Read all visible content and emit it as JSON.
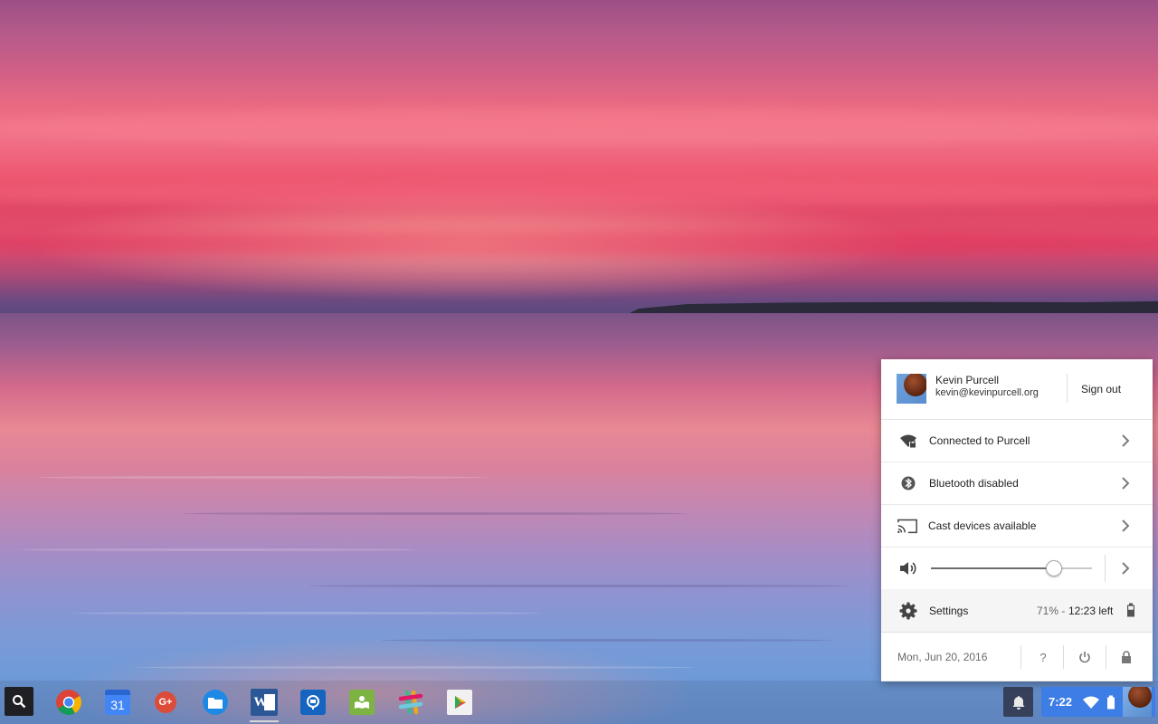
{
  "tray": {
    "user": {
      "name": "Kevin Purcell",
      "email": "kevin@kevinpurcell.org",
      "sign_out_label": "Sign out"
    },
    "network": {
      "label": "Connected to Purcell",
      "icon": "wifi-locked-icon"
    },
    "bluetooth": {
      "label": "Bluetooth disabled",
      "icon": "bluetooth-icon"
    },
    "cast": {
      "label": "Cast devices available",
      "icon": "cast-icon"
    },
    "volume": {
      "level": 0.76,
      "icon": "volume-icon"
    },
    "settings": {
      "label": "Settings",
      "battery_percent": "71%",
      "battery_separator": "-",
      "battery_time": "12:23 left"
    },
    "footer": {
      "date": "Mon, Jun 20, 2016",
      "help_label": "?"
    }
  },
  "shelf": {
    "apps": [
      {
        "name": "Chrome",
        "icon": "chrome-icon"
      },
      {
        "name": "Calendar",
        "icon": "calendar-icon",
        "label": "31"
      },
      {
        "name": "Google+",
        "icon": "google-plus-icon",
        "label": "G+"
      },
      {
        "name": "Files",
        "icon": "files-icon"
      },
      {
        "name": "Word",
        "icon": "word-icon",
        "label": "W"
      },
      {
        "name": "Remote Desktop",
        "icon": "remote-desktop-icon"
      },
      {
        "name": "Reader",
        "icon": "reader-icon"
      },
      {
        "name": "Slack",
        "icon": "slack-icon"
      },
      {
        "name": "Play Store",
        "icon": "play-store-icon"
      }
    ],
    "status": {
      "time": "7:22"
    }
  },
  "colors": {
    "status_area": "#3d7de6",
    "tray_bg": "#ffffff",
    "settings_row_bg": "#f5f5f5"
  }
}
